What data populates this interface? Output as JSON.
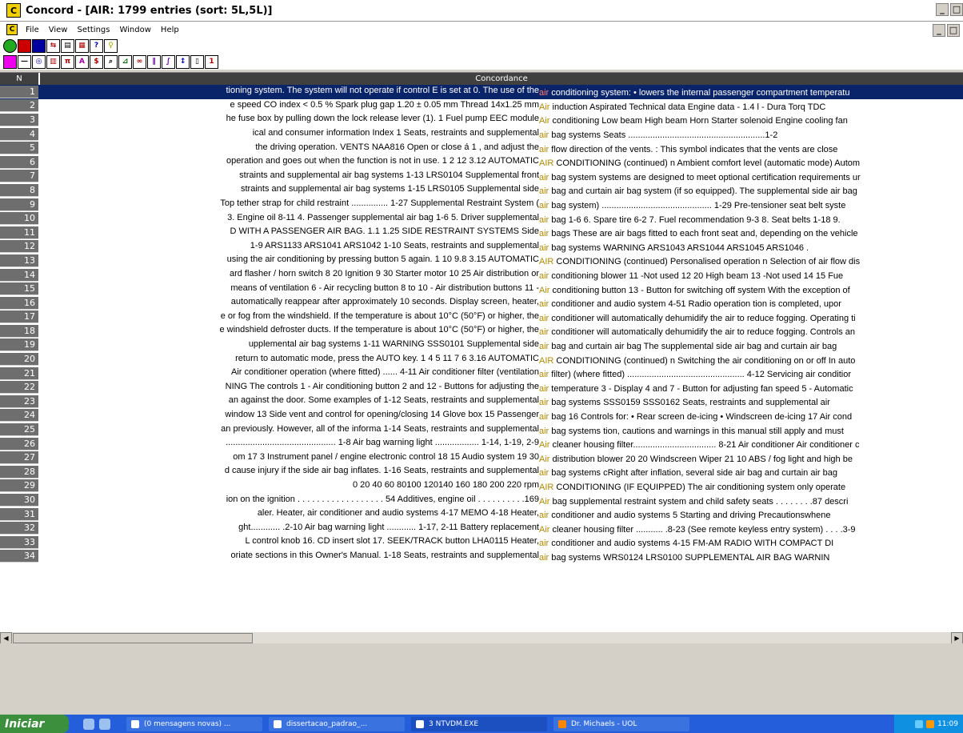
{
  "window": {
    "title": "Concord - [AIR: 1799 entries (sort: 5L,5L)]",
    "app_icon": "C"
  },
  "menu": [
    "File",
    "View",
    "Settings",
    "Window",
    "Help"
  ],
  "toolbar1_icons": [
    "stop-icon",
    "save-icon",
    "save-all-icon",
    "merge-icon",
    "print-icon",
    "print-preview-icon",
    "help-icon",
    "hint-icon"
  ],
  "toolbar2_icons": [
    "color-icon",
    "line-icon",
    "target-icon",
    "columns-icon",
    "pi-icon",
    "font-icon",
    "recalc-icon",
    "search-icon",
    "cluster-icon",
    "pattern-icon",
    "patterns-icon",
    "plot-icon",
    "sort-icon",
    "clipboard-icon",
    "info-icon"
  ],
  "grid": {
    "col_n": "N",
    "col_concordance": "Concordance",
    "rows": [
      {
        "n": "1",
        "left": "tioning system.  The system will not operate if  control E is set at 0.  The use of the",
        "kw": "air",
        "right": "conditioning  system:  • lowers the internal passenger  compartment temperatu"
      },
      {
        "n": "2",
        "left": "e speed CO index < 0.5 %   Spark plug gap 1.20 ± 0.05 mm   Thread 14x1.25 mm",
        "kw": "Air",
        "right": "induction Aspirated        Technical data     Engine data - 1.4 l - Dura Torq TDC"
      },
      {
        "n": "3",
        "left": "he fuse box by pulling  down the lock release lever (1).  1  Fuel pump  EEC module",
        "kw": "Air",
        "right": "conditioning  Low beam  High beam  Horn  Starter solenoid  Engine cooling fan"
      },
      {
        "n": "4",
        "left": "ical and consumer information       Index          1 Seats, restraints and supplemental",
        "kw": "air",
        "right": "bag systems     Seats ........................................................1-2"
      },
      {
        "n": "5",
        "left": "the   driving operation.     VENTS      NAA816  Open or close á   1 , and adjust the",
        "kw": "air",
        "right": "flow direction of the vents.        : This symbol indicates that the vents are  close"
      },
      {
        "n": "6",
        "left": "operation and goes out when the  function is not in use.  1 2  12  3.12  AUTOMATIC",
        "kw": "AIR",
        "right": "CONDITIONING (continued)  n Ambient comfort level  (automatic mode)  Autom"
      },
      {
        "n": "7",
        "left": "straints and supplemental air bag systems 1-13        LRS0104   Supplemental front",
        "kw": "air",
        "right": "bag system systems are designed to meet optional certification requirements ur"
      },
      {
        "n": "8",
        "left": "straints and supplemental air bag systems 1-15        LRS0105   Supplemental side",
        "kw": "air",
        "right": "bag and curtain air bag system (if so equipped).    The supplemental side air bag"
      },
      {
        "n": "9",
        "left": "Top tether strap for child restraint ............... 1-27  Supplemental Restraint System  (",
        "kw": "air",
        "right": "bag system) ............................................. 1-29  Pre-tensioner seat belt syste"
      },
      {
        "n": "10",
        "left": "3.  Engine oil 8-11   4.  Passenger supplemental air bag 1-6   5.  Driver supplemental",
        "kw": "air",
        "right": "bag 1-6   6.  Spare tire 6-2   7.  Fuel recommendation 9-3   8.  Seat belts 1-18   9."
      },
      {
        "n": "11",
        "left": "D WITH A PASSENGER AIR BAG.  1.1  1.25  SIDE RESTRAINT SYSTEMS  Side",
        "kw": "air",
        "right": "bags  These are air bags fitted to each  front seat and, depending on the  vehicle"
      },
      {
        "n": "12",
        "left": "1-9       ARS1133 ARS1041   ARS1042   1-10 Seats, restraints and supplemental",
        "kw": "air",
        "right": "bag systems        WARNING  ARS1043  ARS1044  ARS1045  ARS1046  ."
      },
      {
        "n": "13",
        "left": "using the air conditioning  by pressing button 5 again.  1  10 9.8  3.15  AUTOMATIC",
        "kw": "AIR",
        "right": "CONDITIONING (continued)  Personalised operation  n Selection of air flow  dis"
      },
      {
        "n": "14",
        "left": "ard flasher / horn switch   8 20  Ignition   9 30 Starter motor   10 25 Air distribution or",
        "kw": "air",
        "right": "conditioning blower   11 -Not used   12 20 High beam   13 -Not used   14 15 Fue"
      },
      {
        "n": "15",
        "left": "means of ventilation  6 - Air recycling button  8 to 10 - Air distribution buttons  11 -",
        "kw": "Air",
        "right": "conditioning button  13 - Button for switching  off system  With the exception of"
      },
      {
        "n": "16",
        "left": "automatically reappear after approximately 10   seconds.     Display screen, heater,",
        "kw": "air",
        "right": "conditioner and audio system 4-51        Radio operation tion is completed, upor"
      },
      {
        "n": "17",
        "left": "e or fog from the windshield. If the  temperature is about 10°C (50°F)  or higher, the",
        "kw": "air",
        "right": "conditioner will  automatically dehumidify the air to  reduce fogging.  Operating ti"
      },
      {
        "n": "18",
        "left": "e  windshield defroster ducts. If the  temperature is about 10°C (50°F)  or higher, the",
        "kw": "air",
        "right": "conditioner will  automatically dehumidify the air to  reduce fogging.  Controls an"
      },
      {
        "n": "19",
        "left": "upplemental air bag systems 1-11         WARNING  SSS0101  Supplemental side",
        "kw": "air",
        "right": "bag and curtain   air bag      The supplemental side air bag and   curtain air bag"
      },
      {
        "n": "20",
        "left": "return to automatic mode,  press the AUTO key.  1 4 5  11 7 6  3.16  AUTOMATIC",
        "kw": "AIR",
        "right": "CONDITIONING (continued)  n Switching the air  conditioning on or off  In auto"
      },
      {
        "n": "21",
        "left": "Air conditioner operation (where fitted) ...... 4-11    Air conditioner filter (ventilation",
        "kw": "air",
        "right": "filter)   (where fitted) ................................................ 4-12   Servicing air conditior"
      },
      {
        "n": "22",
        "left": "NING  The controls  1 - Air conditioning button  2 and 12 - Buttons for adjusting  the",
        "kw": "air",
        "right": "temperature  3 - Display  4 and 7 - Button for adjusting  fan speed  5 - Automatic"
      },
      {
        "n": "23",
        "left": "an    against the door. Some examples of   1-12 Seats, restraints and supplemental",
        "kw": "air",
        "right": "bag systems         SSS0159 SSS0162   Seats, restraints and supplemental air"
      },
      {
        "n": "24",
        "left": "window  13 Side vent and control for  opening/closing  14 Glove box  15 Passenger",
        "kw": "air",
        "right": "bag  16  Controls for:  • Rear screen de-icing  • Windscreen de-icing  17 Air cond"
      },
      {
        "n": "25",
        "left": "an previously. However, all of the informa    1-14 Seats, restraints and supplemental",
        "kw": "air",
        "right": "bag systems      tion, cautions and warnings in this manual   still apply and must"
      },
      {
        "n": "26",
        "left": "............................................. 1-8   Air bag warning light .................. 1-14, 1-19, 2-9",
        "kw": "Air",
        "right": "cleaner housing filter.................................. 8-21   Air conditioner  Air conditioner c"
      },
      {
        "n": "27",
        "left": "om   17 3  Instrument panel / engine electronic control   18 15  Audio system   19 30",
        "kw": "Air",
        "right": "distribution blower   20 20 Windscreen Wiper   21  10  ABS / fog light and high be"
      },
      {
        "n": "28",
        "left": "d cause injury if the side   air bag inflates.    1-16 Seats, restraints and supplemental",
        "kw": "air",
        "right": "bag systems          cRight after inflation, several side air   bag and curtain air bag"
      },
      {
        "n": "29",
        "left": "0   20   40   60   80100  120140   160   180   200            220  rpm",
        "kw": "AIR",
        "right": "CONDITIONING    (IF EQUIPPED)    The air conditioning system   only operate"
      },
      {
        "n": "30",
        "left": "ion on  the ignition . . . . . . . . . . . . . . . . . . 54  Additives, engine oil . . . . . . . . . .169",
        "kw": "Air",
        "right": "bag supplemental  restraint system  and child safety seats . . . . . . . .87  descri"
      },
      {
        "n": "31",
        "left": "aler.  Heater, air conditioner and audio systems 4-17         MEMO      4-18 Heater,",
        "kw": "air",
        "right": "conditioner and audio systems          5 Starting and driving    Precautionswhene"
      },
      {
        "n": "32",
        "left": "ght............ .2-10      Air bag warning light ............ 1-17, 2-11 Battery replacement",
        "kw": "Air",
        "right": "cleaner housing filter ........... .8-23 (See remote keyless entry system) . . . .3-9"
      },
      {
        "n": "33",
        "left": "L control knob   16.  CD insert slot   17.  SEEK/TRACK button   LHA0115    Heater,",
        "kw": "air",
        "right": "conditioner and audio systems 4-15         FM-AM RADIO WITH COMPACT  DI"
      },
      {
        "n": "34",
        "left": "oriate sections in this   Owner's Manual.    1-18 Seats, restraints and supplemental",
        "kw": "air",
        "right": "bag systems          WRS0124 LRS0100   SUPPLEMENTAL AIR BAG  WARNIN"
      }
    ]
  },
  "taskbar": {
    "start_label": "Iniciar",
    "tasks": [
      "(0 mensagens novas) ...",
      "dissertacao_padrao_...",
      "3 NTVDM.EXE",
      "Dr. Michaels - UOL"
    ],
    "clock": "11:09"
  }
}
